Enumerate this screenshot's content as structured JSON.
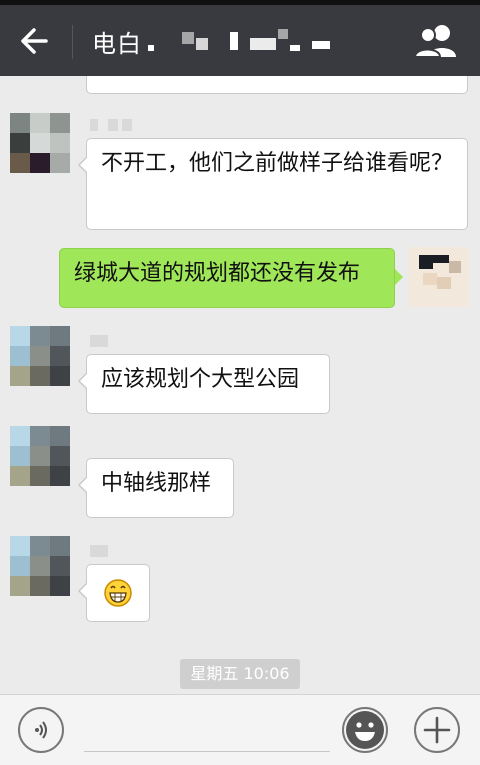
{
  "header": {
    "title": "电白",
    "back_icon": "back-arrow-icon",
    "contacts_icon": "group-members-icon",
    "background": "#393a3f"
  },
  "messages": [
    {
      "side": "left",
      "text": "不开工，他们之前做样子给谁看呢？"
    },
    {
      "side": "right",
      "text": "绿城大道的规划都还没有发布"
    },
    {
      "side": "left",
      "text": "应该规划个大型公园"
    },
    {
      "side": "left",
      "text": "中轴线那样"
    },
    {
      "side": "left",
      "text": "grinning-emoji",
      "kind": "emoji"
    }
  ],
  "timestamp": "星期五 10:06",
  "bottom_bar": {
    "voice_icon": "voice-input-icon",
    "emoji_icon": "emoji-icon",
    "plus_icon": "add-icon"
  },
  "colors": {
    "sent_bubble": "#9fe658",
    "received_bubble": "#ffffff",
    "chat_bg": "#ebebeb"
  }
}
